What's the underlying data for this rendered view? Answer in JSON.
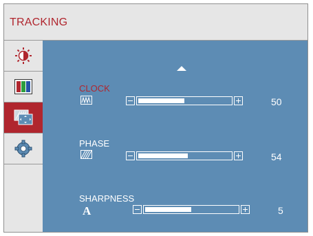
{
  "title": "TRACKING",
  "colors": {
    "accent": "#b0262e",
    "panel": "#5d8cb4",
    "frame": "#e6e6e6"
  },
  "sidebar": {
    "items": [
      {
        "icon": "brightness-contrast-icon",
        "active": false
      },
      {
        "icon": "color-bars-icon",
        "active": false
      },
      {
        "icon": "tracking-screen-icon",
        "active": true
      },
      {
        "icon": "gear-icon",
        "active": false
      }
    ]
  },
  "settings": [
    {
      "label": "CLOCK",
      "icon": "clock-icon",
      "value": "50",
      "level": 0.5,
      "selected": true
    },
    {
      "label": "PHASE",
      "icon": "phase-icon",
      "value": "54",
      "level": 0.54,
      "selected": false
    },
    {
      "label": "SHARPNESS",
      "icon": "sharpness-icon",
      "value": "5",
      "level": 0.5,
      "selected": false
    }
  ]
}
